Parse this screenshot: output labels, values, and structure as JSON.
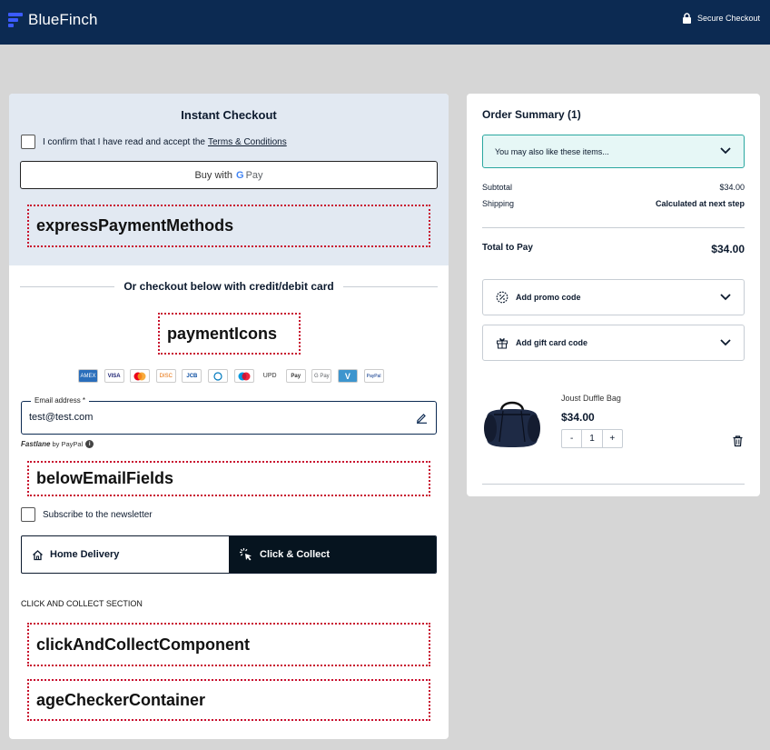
{
  "header": {
    "brand_name": "BlueFinch",
    "secure_label": "Secure Checkout",
    "bg_color": "#0c2a52"
  },
  "express": {
    "title": "Instant Checkout",
    "terms_prefix": "I confirm that I have read and accept the",
    "terms_link": "Terms & Conditions",
    "buy_with": "Buy with",
    "gpay_g": "G",
    "gpay_pay": "Pay",
    "placeholder": "expressPaymentMethods"
  },
  "card_checkout": {
    "divider_text": "Or checkout below with credit/debit card",
    "payment_icons_placeholder": "paymentIcons",
    "payment_icons": [
      "AMEX",
      "VISA",
      "MC",
      "DISC",
      "JCB",
      "DINERS",
      "MAESTRO",
      "UPD",
      "Pay",
      "G Pay",
      "V",
      "PayPal"
    ],
    "email_label": "Email address *",
    "email_value": "test@test.com",
    "fastlane_label": "Fastlane",
    "fastlane_by": "by PayPal",
    "below_email_placeholder": "belowEmailFields",
    "newsletter_label": "Subscribe to the newsletter",
    "delivery_tabs": [
      {
        "label": "Home Delivery",
        "active": false
      },
      {
        "label": "Click & Collect",
        "active": true
      }
    ],
    "cc_section_title": "CLICK AND COLLECT SECTION",
    "cc_component_placeholder": "clickAndCollectComponent",
    "age_checker_placeholder": "ageCheckerContainer"
  },
  "summary": {
    "title": "Order Summary (1)",
    "suggest_label": "You may also like these items...",
    "subtotal_label": "Subtotal",
    "subtotal_value": "$34.00",
    "shipping_label": "Shipping",
    "shipping_value": "Calculated at next step",
    "total_label": "Total to Pay",
    "total_value": "$34.00",
    "promo_label": "Add promo code",
    "gift_label": "Add gift card code",
    "product": {
      "name": "Joust Duffle Bag",
      "price": "$34.00",
      "qty": "1",
      "minus": "-",
      "plus": "+"
    }
  }
}
